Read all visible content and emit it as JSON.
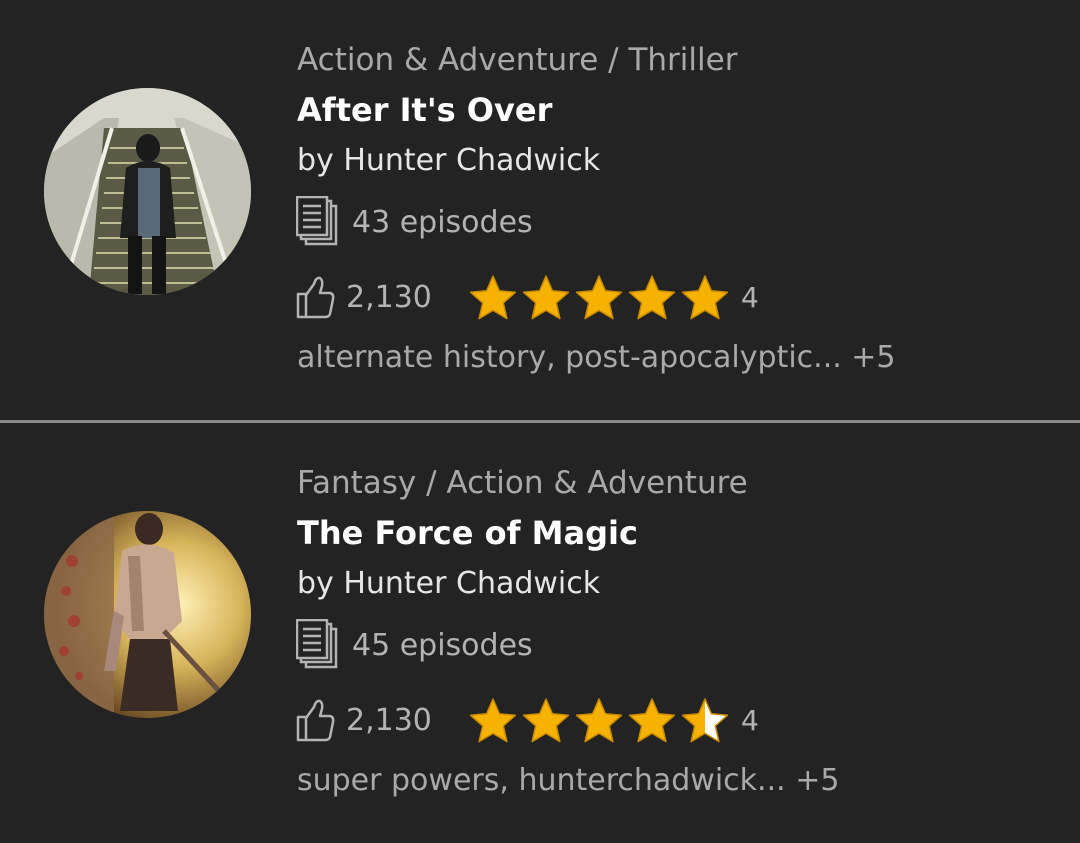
{
  "colors": {
    "background": "#232323",
    "divider": "#8a8a8a",
    "star_gold": "#f5b200",
    "muted_text": "#a9a9a9"
  },
  "stories": [
    {
      "genre": "Action & Adventure / Thriller",
      "title": "After It's Over",
      "author": "by Hunter Chadwick",
      "episodes": "43 episodes",
      "likes": "2,130",
      "stars_filled": 5,
      "rating_count": "4",
      "tags": "alternate history, post-apocalyptic... +5",
      "cover_icon": "man-on-stairs-image"
    },
    {
      "genre": "Fantasy / Action & Adventure",
      "title": "The Force of Magic",
      "author": "by Hunter Chadwick",
      "episodes": "45 episodes",
      "likes": "2,130",
      "stars_filled": 4.5,
      "rating_count": "4",
      "tags": "super powers, hunterchadwick... +5",
      "cover_icon": "warrior-magic-image"
    }
  ]
}
